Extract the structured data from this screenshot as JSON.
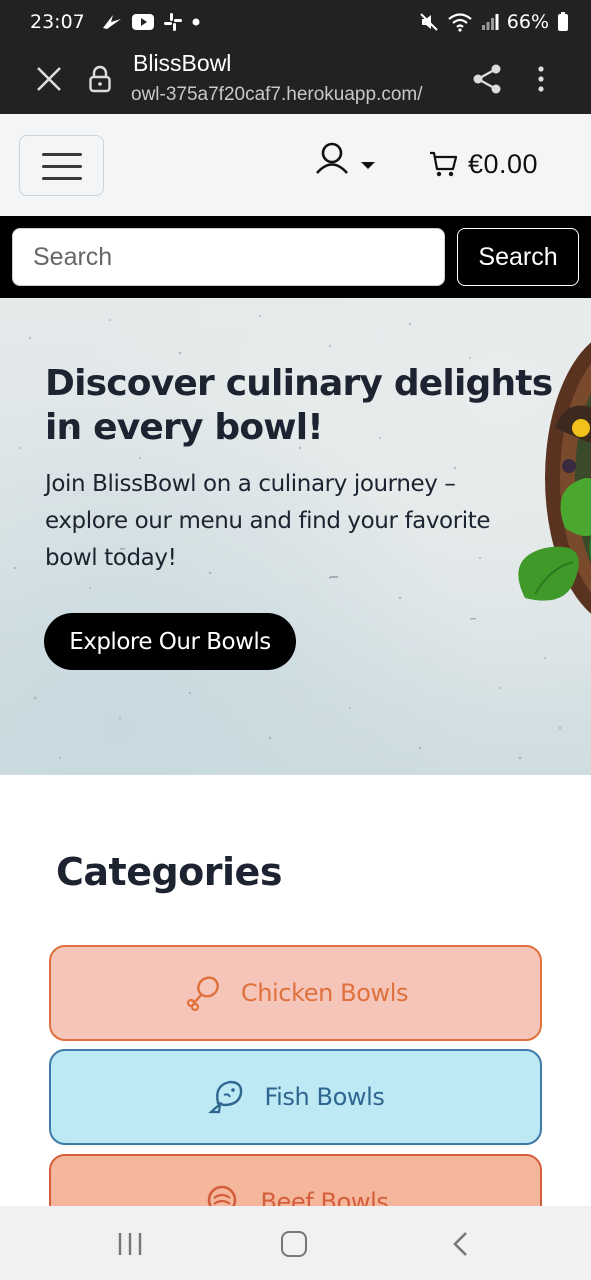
{
  "status_bar": {
    "time": "23:07",
    "battery": "66%",
    "left_icons": [
      "notification-icon",
      "youtube-icon",
      "slack-icon",
      "dot-icon"
    ],
    "right_icons": [
      "mute-icon",
      "wifi-icon",
      "signal-icon",
      "battery-icon"
    ]
  },
  "browser": {
    "title": "BlissBowl",
    "url": "owl-375a7f20caf7.herokuapp.com/"
  },
  "header": {
    "cart_total": "€0.00"
  },
  "search": {
    "placeholder": "Search",
    "button_label": "Search"
  },
  "hero": {
    "title": "Discover culinary delights in every bowl!",
    "text": "Join BlissBowl on a culinary journey – explore our menu and find your favorite bowl today!",
    "cta_label": "Explore Our Bowls"
  },
  "categories": {
    "title": "Categories",
    "items": [
      {
        "label": "Chicken Bowls",
        "icon": "drumstick-icon",
        "color": "#e0703c"
      },
      {
        "label": "Fish Bowls",
        "icon": "fish-icon",
        "color": "#2f6690"
      },
      {
        "label": "Beef Bowls",
        "icon": "meat-icon",
        "color": "#d45e3b"
      }
    ]
  },
  "colors": {
    "dark_bar": "#222222",
    "header_bg": "#f4f5f7",
    "search_bar_bg": "#000000",
    "chicken_bg": "#f4c5b8",
    "fish_bg": "#bde9f5",
    "beef_bg": "#f4b79b"
  }
}
